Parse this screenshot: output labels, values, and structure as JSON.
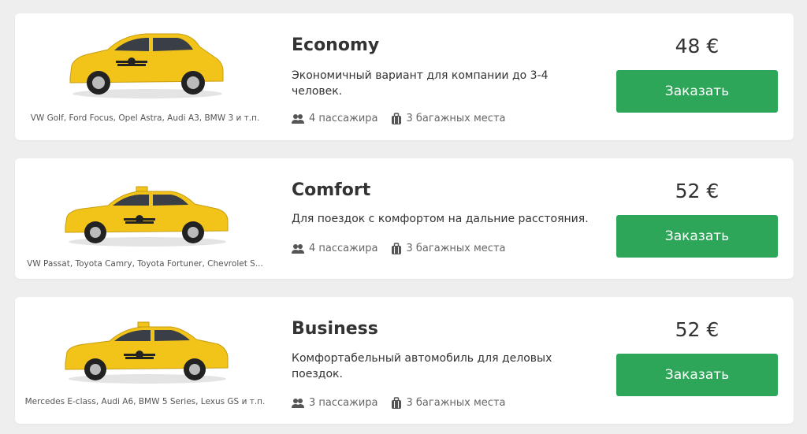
{
  "tariffs": [
    {
      "title": "Economy",
      "description": "Экономичный вариант для компании до 3-4 человек.",
      "models": "VW Golf, Ford Focus, Opel Astra, Audi A3, BMW 3 и т.п.",
      "passengers": "4 пассажира",
      "luggage": "3 багажных места",
      "price": "48 €",
      "button": "Заказать"
    },
    {
      "title": "Comfort",
      "description": "Для поездок с комфортом на дальние расстояния.",
      "models": "VW Passat, Toyota Camry, Toyota Fortuner, Chevrolet S...",
      "passengers": "4 пассажира",
      "luggage": "3 багажных места",
      "price": "52 €",
      "button": "Заказать"
    },
    {
      "title": "Business",
      "description": "Комфортабельный автомобиль для деловых поездок.",
      "models": "Mercedes E-class, Audi A6, BMW 5 Series, Lexus GS и т.п.",
      "passengers": "3 пассажира",
      "luggage": "3 багажных места",
      "price": "52 €",
      "button": "Заказать"
    }
  ],
  "colors": {
    "card_bg": "#ffffff",
    "page_bg": "#eeeeee",
    "button": "#2ea65a",
    "car_yellow": "#f2c318"
  },
  "icons": {
    "passengers": "users-icon",
    "luggage": "suitcase-icon"
  }
}
